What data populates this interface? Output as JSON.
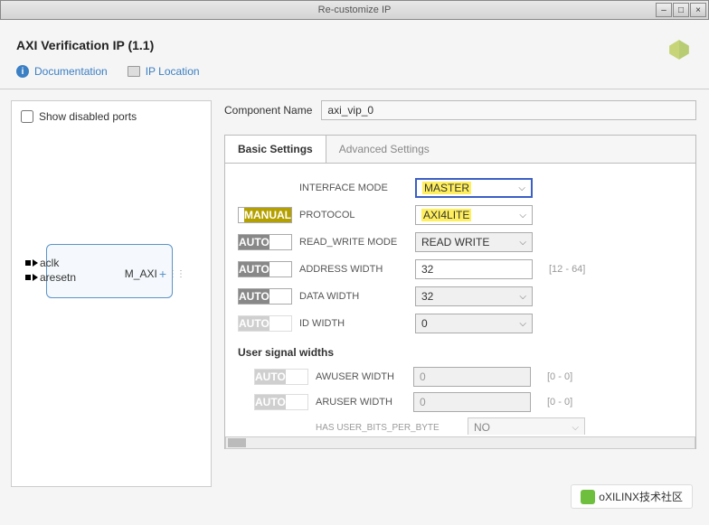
{
  "window": {
    "title": "Re-customize IP"
  },
  "page": {
    "title": "AXI Verification IP (1.1)"
  },
  "toolbar": {
    "doc": "Documentation",
    "iploc": "IP Location"
  },
  "left": {
    "show_disabled": "Show disabled ports",
    "port_aclk": "aclk",
    "port_aresetn": "aresetn",
    "port_maxi": "M_AXI"
  },
  "comp": {
    "label": "Component Name",
    "value": "axi_vip_0"
  },
  "tabs": {
    "basic": "Basic Settings",
    "advanced": "Advanced Settings"
  },
  "settings": {
    "interface_mode": {
      "label": "INTERFACE MODE",
      "value": "MASTER"
    },
    "protocol": {
      "label": "PROTOCOL",
      "value": "AXI4LITE",
      "toggle": "MANUAL"
    },
    "rw_mode": {
      "label": "READ_WRITE MODE",
      "value": "READ WRITE",
      "toggle": "AUTO"
    },
    "addr_width": {
      "label": "ADDRESS WIDTH",
      "value": "32",
      "hint": "[12 - 64]",
      "toggle": "AUTO"
    },
    "data_width": {
      "label": "DATA WIDTH",
      "value": "32",
      "toggle": "AUTO"
    },
    "id_width": {
      "label": "ID WIDTH",
      "value": "0",
      "toggle": "AUTO"
    }
  },
  "user_widths": {
    "header": "User signal widths",
    "awuser": {
      "label": "AWUSER WIDTH",
      "value": "0",
      "hint": "[0 - 0]"
    },
    "aruser": {
      "label": "ARUSER WIDTH",
      "value": "0",
      "hint": "[0 - 0]"
    },
    "has_user_bits": {
      "label": "HAS USER_BITS_PER_BYTE",
      "value": "NO"
    }
  },
  "watermark": {
    "text": "oXILINX技术社区"
  }
}
